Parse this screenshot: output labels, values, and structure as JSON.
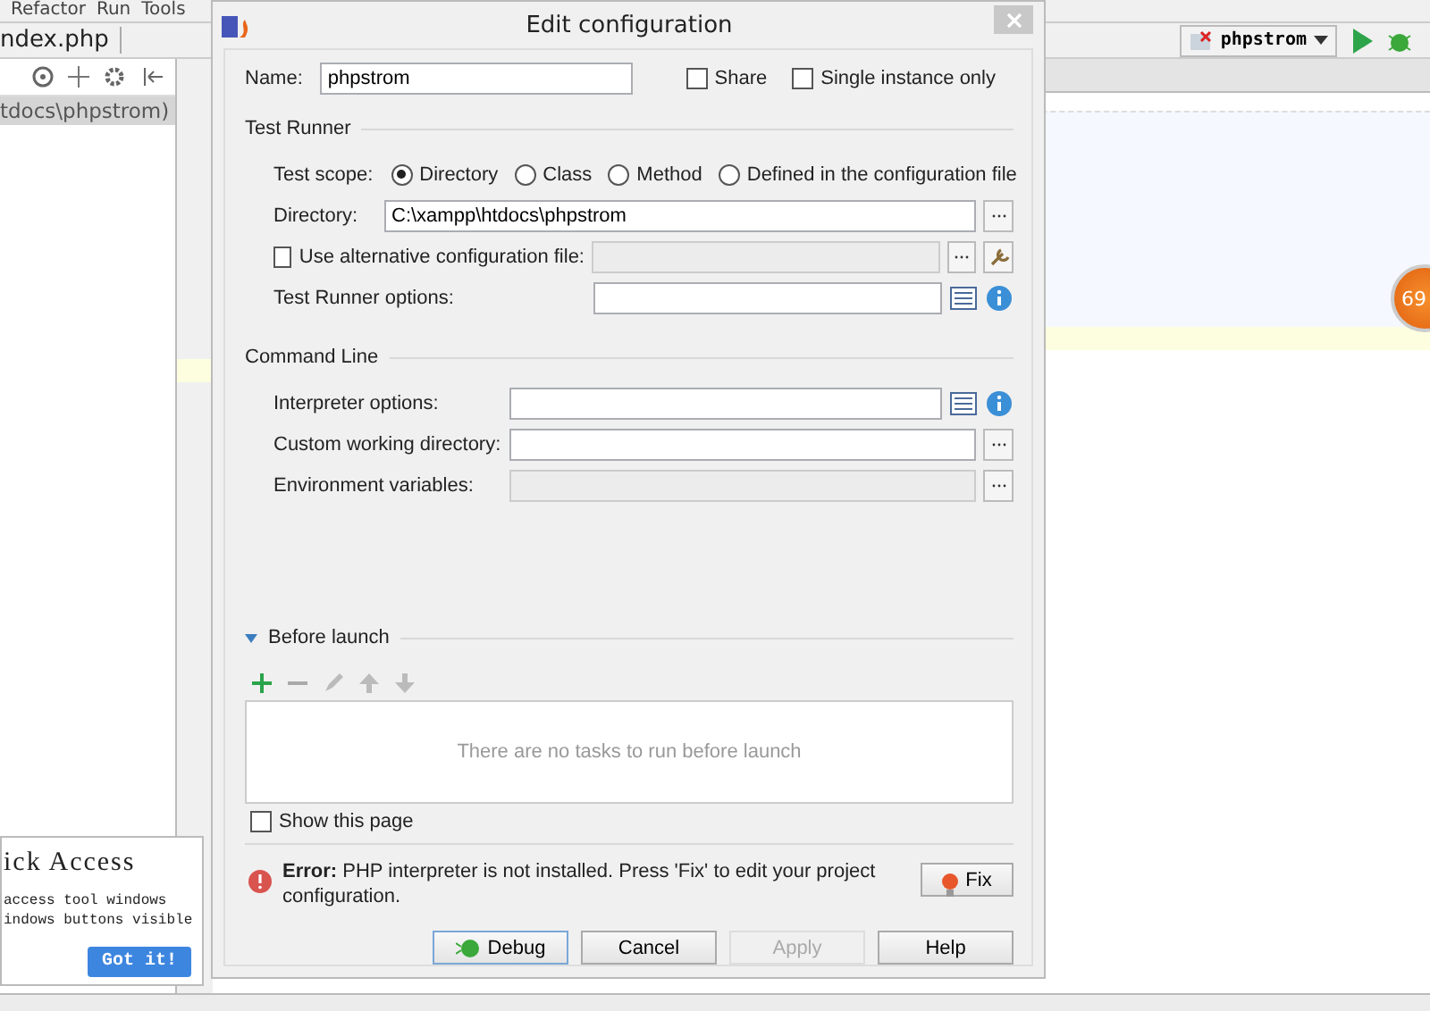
{
  "menu_bar": {
    "items": [
      "Refactor",
      "Run",
      "Tools"
    ]
  },
  "breadcrumb": {
    "label": "ndex.php"
  },
  "project_tree": {
    "items": [
      {
        "label": "tdocs\\phpstrom)",
        "selected": true
      }
    ]
  },
  "run_config": {
    "label": "phpstrom"
  },
  "progress_badge": {
    "label": "69"
  },
  "dialog": {
    "title": "Edit configuration",
    "name": {
      "label": "Name:",
      "value": "phpstrom"
    },
    "options": [
      {
        "label": "Share",
        "checked": false
      },
      {
        "label": "Single instance only",
        "checked": false
      }
    ],
    "test_runner": {
      "title": "Test Runner",
      "scope_label": "Test scope:",
      "scopes": [
        {
          "label": "Directory",
          "selected": true
        },
        {
          "label": "Class",
          "selected": false
        },
        {
          "label": "Method",
          "selected": false
        },
        {
          "label": "Defined in the configuration file",
          "selected": false
        }
      ],
      "directory": {
        "label": "Directory:",
        "value": "C:\\xampp\\htdocs\\phpstrom"
      },
      "alt_config": {
        "label": "Use alternative configuration file:",
        "checked": false
      },
      "runner_options": {
        "label": "Test Runner options:"
      }
    },
    "command_line": {
      "title": "Command Line",
      "fields": [
        {
          "label": "Interpreter options:",
          "kind": "options"
        },
        {
          "label": "Custom working directory:",
          "kind": "browse"
        },
        {
          "label": "Environment variables:",
          "kind": "env"
        }
      ]
    },
    "before_launch": {
      "title": "Before launch",
      "expanded": true,
      "empty_text": "There are no tasks to run before launch",
      "show_page": {
        "label": "Show this page",
        "checked": false
      }
    },
    "error": {
      "message": "**Error:** PHP interpreter is not installed. Press 'Fix' to edit your project configuration.",
      "fix_label": "Fix"
    },
    "buttons": [
      {
        "label": "Debug",
        "kind": "debug",
        "disabled": false
      },
      {
        "label": "Cancel",
        "kind": "plain",
        "disabled": false
      },
      {
        "label": "Apply",
        "kind": "plain",
        "disabled": true
      },
      {
        "label": "Help",
        "kind": "plain",
        "disabled": false
      }
    ]
  },
  "quick_access": {
    "title": "ick Access",
    "lines": [
      "access tool windows",
      "indows buttons visible"
    ],
    "button": "Got it!"
  }
}
